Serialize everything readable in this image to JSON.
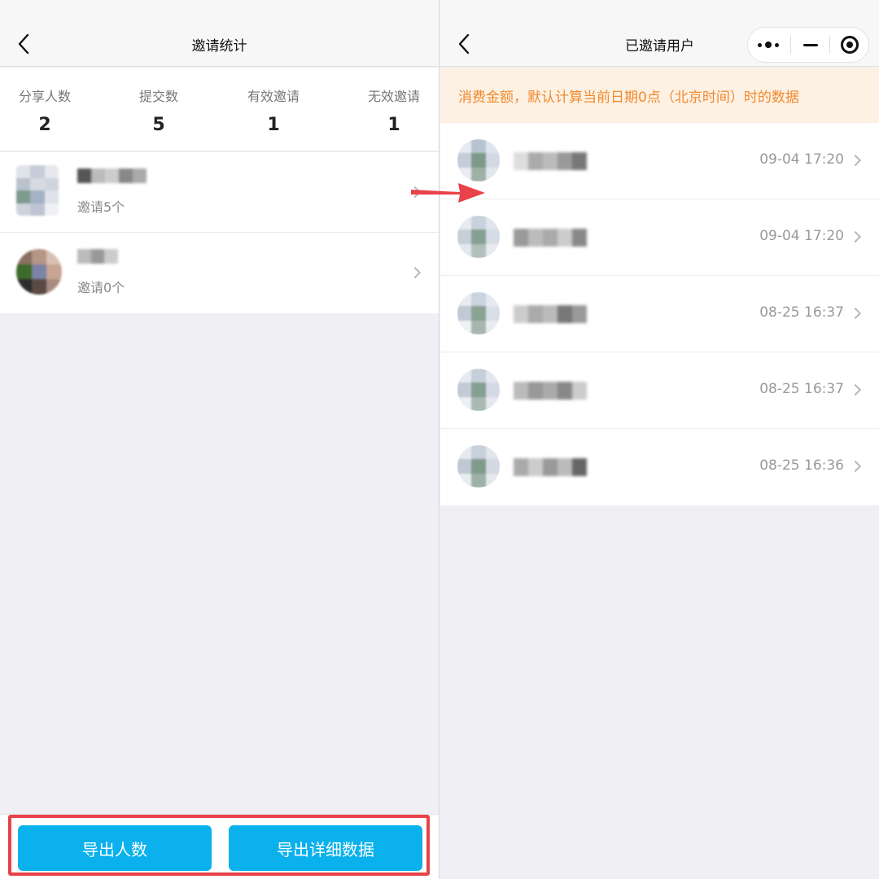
{
  "left_page": {
    "title": "邀请统计",
    "stats": [
      {
        "label": "分享人数",
        "value": "2"
      },
      {
        "label": "提交数",
        "value": "5"
      },
      {
        "label": "有效邀请",
        "value": "1"
      },
      {
        "label": "无效邀请",
        "value": "1"
      }
    ],
    "sharers": [
      {
        "subtitle": "邀请5个"
      },
      {
        "subtitle": "邀请0个"
      }
    ],
    "buttons": {
      "export_count": "导出人数",
      "export_detail": "导出详细数据"
    }
  },
  "right_page": {
    "title": "已邀请用户",
    "notice": "消费金额，默认计算当前日期0点（北京时间）时的数据",
    "users": [
      {
        "time": "09-04 17:20"
      },
      {
        "time": "09-04 17:20"
      },
      {
        "time": "08-25 16:37"
      },
      {
        "time": "08-25 16:37"
      },
      {
        "time": "08-25 16:36"
      }
    ]
  },
  "colors": {
    "accent_button": "#0ab1ec",
    "notice_bg": "#fdf1e4",
    "notice_text": "#f28a2e",
    "highlight": "#e8424a"
  }
}
